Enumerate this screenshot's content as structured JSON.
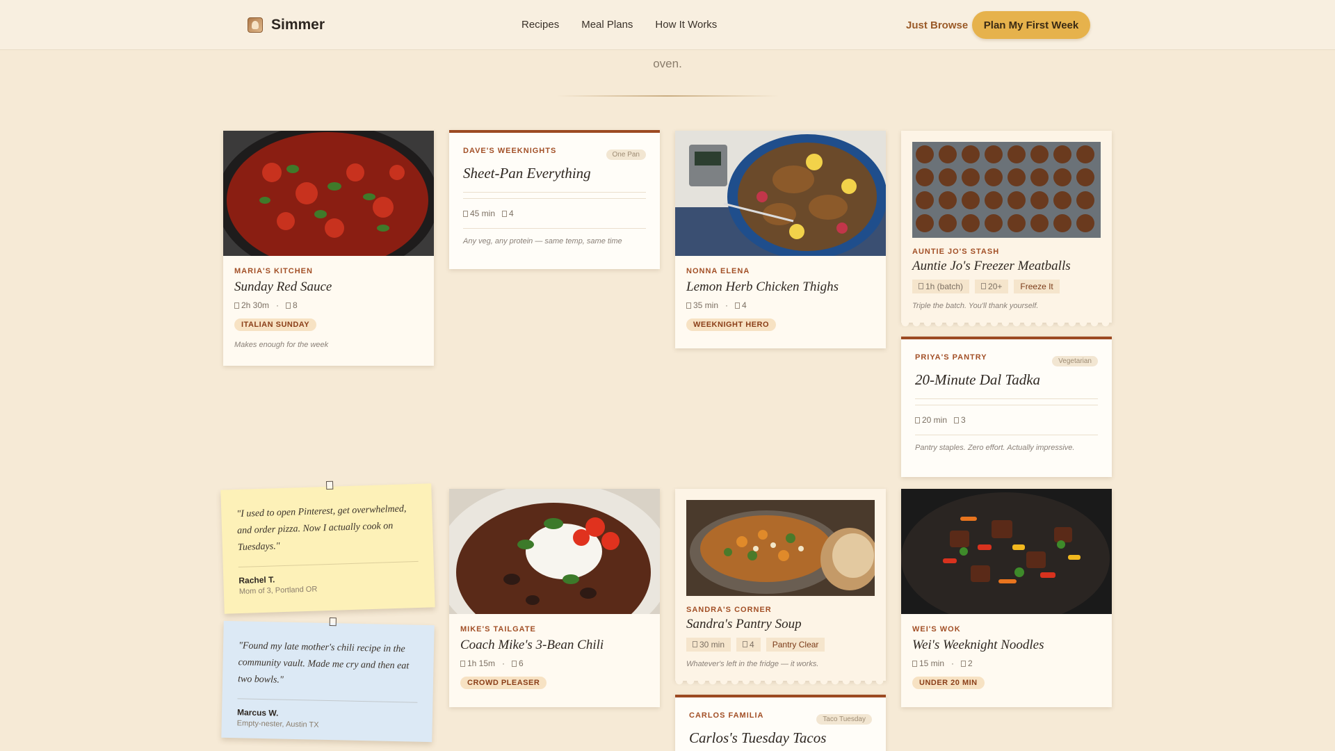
{
  "header": {
    "logo_text": "Simmer",
    "nav": [
      "Recipes",
      "Meal Plans",
      "How It Works"
    ],
    "browse_label": "Just Browse",
    "cta_label": "Plan My First Week"
  },
  "hero": {
    "tail_text": "oven."
  },
  "cards": {
    "sunday_sauce": {
      "source": "Maria's Kitchen",
      "title": "Sunday Red Sauce",
      "time": "2h 30m",
      "serves": "8",
      "tag": "Italian Sunday",
      "note": "Makes enough for the week"
    },
    "sheet_pan": {
      "source": "Dave's Weeknights",
      "pill": "One Pan",
      "title": "Sheet-Pan Everything",
      "time": "45 min",
      "serves": "4",
      "note": "Any veg, any protein — same temp, same time"
    },
    "lemon_chicken": {
      "source": "Nonna Elena",
      "title": "Lemon Herb Chicken Thighs",
      "time": "35 min",
      "serves": "4",
      "tag": "Weeknight Hero"
    },
    "meatballs": {
      "source": "Auntie Jo's Stash",
      "title": "Auntie Jo's Freezer Meatballs",
      "time": "1h (batch)",
      "serves": "20+",
      "chip": "Freeze It",
      "note": "Triple the batch. You'll thank yourself."
    },
    "dal": {
      "source": "Priya's Pantry",
      "pill": "Vegetarian",
      "title": "20-Minute Dal Tadka",
      "time": "20 min",
      "serves": "3",
      "note": "Pantry staples. Zero effort. Actually impressive."
    },
    "chili": {
      "source": "Mike's Tailgate",
      "title": "Coach Mike's 3-Bean Chili",
      "time": "1h 15m",
      "serves": "6",
      "tag": "Crowd Pleaser"
    },
    "soup": {
      "source": "Sandra's Corner",
      "title": "Sandra's Pantry Soup",
      "time": "30 min",
      "serves": "4",
      "chip": "Pantry Clear",
      "note": "Whatever's left in the fridge — it works."
    },
    "noodles": {
      "source": "Wei's Wok",
      "title": "Wei's Weeknight Noodles",
      "time": "15 min",
      "serves": "2",
      "tag": "Under 20 min"
    },
    "tacos": {
      "source": "Carlos Familia",
      "pill": "Taco Tuesday",
      "title": "Carlos's Tuesday Tacos"
    }
  },
  "testimonials": [
    {
      "quote": "\"I used to open Pinterest, get overwhelmed, and order pizza. Now I actually cook on Tuesdays.\"",
      "name": "Rachel T.",
      "detail": "Mom of 3, Portland OR"
    },
    {
      "quote": "\"Found my late mother's chili recipe in the community vault. Made me cry and then eat two bowls.\"",
      "name": "Marcus W.",
      "detail": "Empty-nester, Austin TX"
    }
  ]
}
